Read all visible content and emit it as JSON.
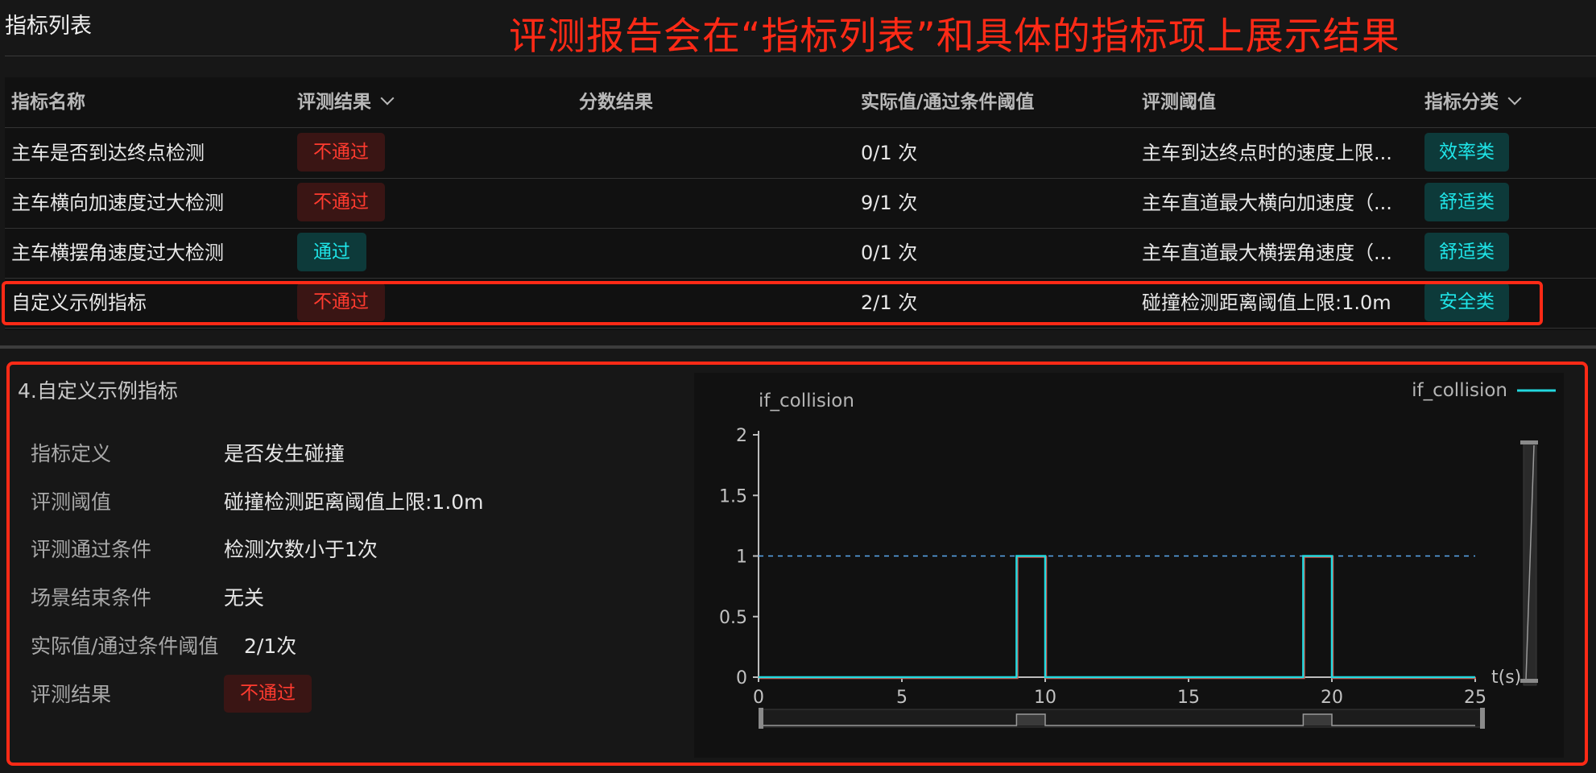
{
  "page": {
    "title": "指标列表",
    "annotation": "评测报告会在“指标列表”和具体的指标项上展示结果"
  },
  "table": {
    "headers": [
      "指标名称",
      "评测结果",
      "分数结果",
      "实际值/通过条件阈值",
      "评测阈值",
      "指标分类"
    ],
    "rows": [
      {
        "name": "主车是否到达终点检测",
        "result": "不通过",
        "status": "fail",
        "score": "",
        "actual": "0/1 次",
        "threshold": "主车到达终点时的速度上限...",
        "category": "效率类"
      },
      {
        "name": "主车横向加速度过大检测",
        "result": "不通过",
        "status": "fail",
        "score": "",
        "actual": "9/1 次",
        "threshold": "主车直道最大横向加速度（...",
        "category": "舒适类"
      },
      {
        "name": "主车横摆角速度过大检测",
        "result": "通过",
        "status": "pass",
        "score": "",
        "actual": "0/1 次",
        "threshold": "主车直道最大横摆角速度（...",
        "category": "舒适类"
      },
      {
        "name": "自定义示例指标",
        "result": "不通过",
        "status": "fail",
        "score": "",
        "actual": "2/1 次",
        "threshold": "碰撞检测距离阈值上限:1.0m",
        "category": "安全类"
      }
    ]
  },
  "detail": {
    "title": "4.自定义示例指标",
    "fields": [
      {
        "label": "指标定义",
        "value": "是否发生碰撞"
      },
      {
        "label": "评测阈值",
        "value": "碰撞检测距离阈值上限:1.0m"
      },
      {
        "label": "评测通过条件",
        "value": "检测次数小于1次"
      },
      {
        "label": "场景结束条件",
        "value": "无关"
      },
      {
        "label": "实际值/通过条件阈值",
        "value": "2/1次"
      }
    ],
    "result_label": "评测结果",
    "result_value": "不通过"
  },
  "chart_data": {
    "type": "line",
    "ylabel": "if_collision",
    "xlabel": "t(s)",
    "legend": "if_collision",
    "legend_position": "top-right",
    "xlim": [
      0,
      25
    ],
    "ylim": [
      0,
      2
    ],
    "x_ticks": [
      0,
      5,
      10,
      15,
      20,
      25
    ],
    "y_ticks": [
      0,
      0.5,
      1,
      1.5,
      2
    ],
    "threshold": 1,
    "series": [
      {
        "name": "if_collision",
        "color": "#22d8de",
        "x": [
          0,
          9,
          9,
          10,
          10,
          19,
          19,
          20,
          20,
          25
        ],
        "y": [
          0,
          0,
          1,
          1,
          0,
          0,
          1,
          1,
          0,
          0
        ]
      }
    ],
    "secondary_color": "#e0473a",
    "threshold_color": "#5aa9f0"
  }
}
